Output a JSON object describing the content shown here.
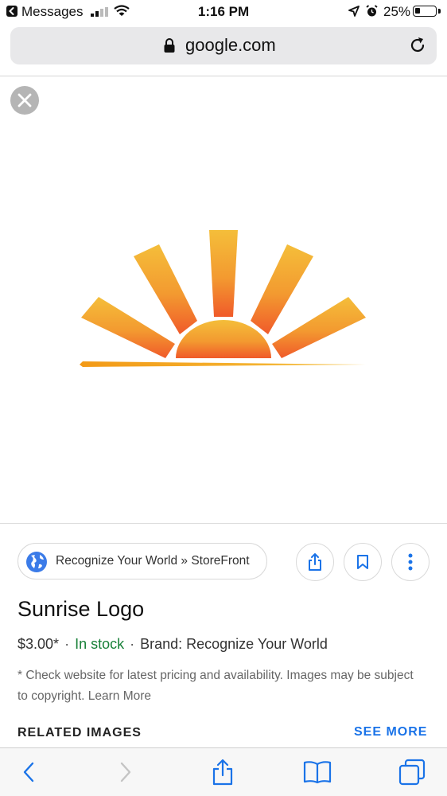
{
  "status_bar": {
    "back_app": "Messages",
    "time": "1:16 PM",
    "battery_percent": "25%",
    "battery_level": 0.25,
    "icons": [
      "back-arrow-icon",
      "signal-icon",
      "wifi-icon",
      "location-icon",
      "alarm-icon",
      "battery-icon"
    ]
  },
  "address_bar": {
    "domain": "google.com",
    "icons": [
      "lock-icon",
      "reload-icon"
    ]
  },
  "viewer": {
    "close_icon": "close-icon",
    "image_subject": "sunrise-logo",
    "colors": {
      "ray_top": "#F4BE3A",
      "ray_bottom": "#F05A2A",
      "horizon": "#F39A16"
    }
  },
  "source": {
    "site_label": "Recognize Your World » StoreFront",
    "icons": [
      "globe-icon",
      "share-icon",
      "bookmark-icon",
      "more-vert-icon"
    ]
  },
  "product": {
    "title": "Sunrise Logo",
    "price": "$3.00*",
    "separator": "·",
    "stock": "In stock",
    "brand": "Brand: Recognize Your World",
    "disclaimer": "* Check website for latest pricing and availability. Images may be subject to copyright.",
    "learn_more": "Learn More"
  },
  "related": {
    "heading": "RELATED IMAGES",
    "see_more": "SEE MORE"
  },
  "toolbar": {
    "icons": [
      "back-icon",
      "forward-icon",
      "share-icon",
      "bookmarks-icon",
      "tabs-icon"
    ]
  },
  "colors": {
    "accent": "#1a73e8",
    "stock_green": "#188038"
  }
}
